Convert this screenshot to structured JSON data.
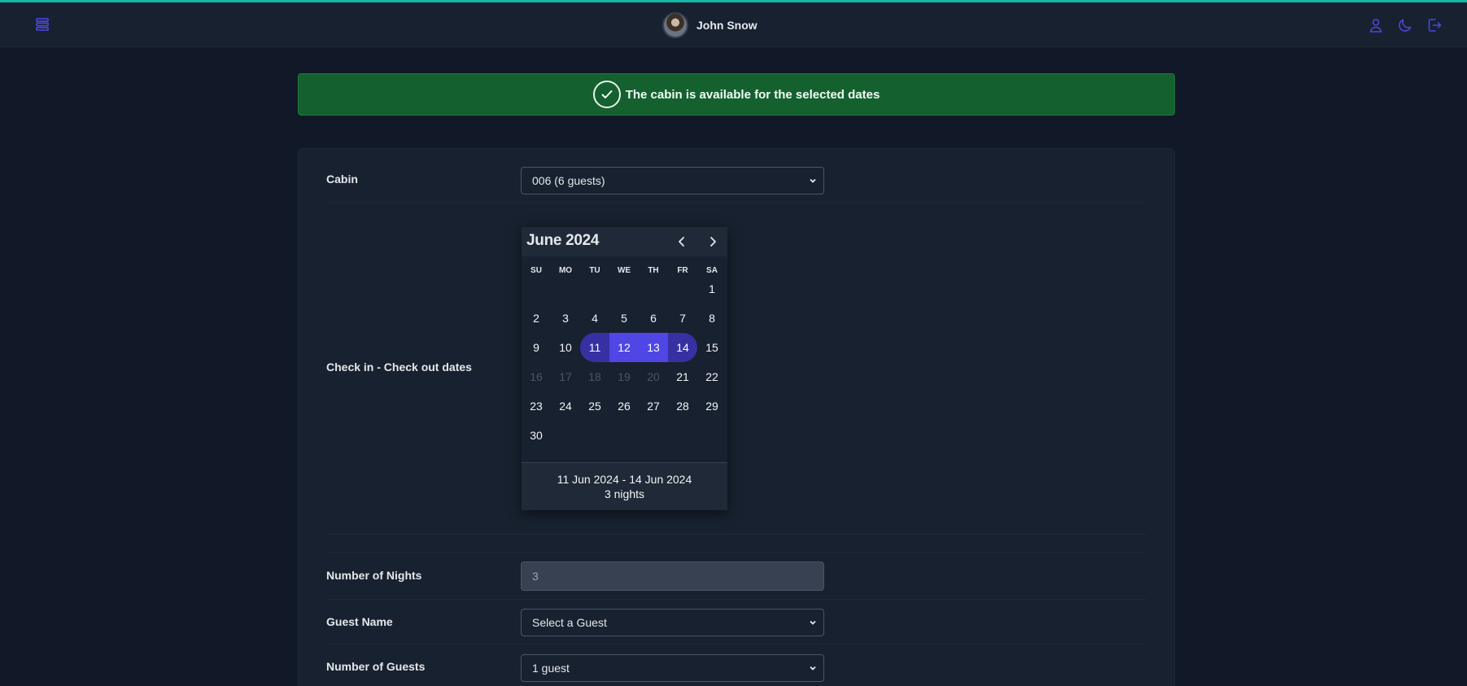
{
  "header": {
    "user_name": "John Snow",
    "accent_color": "#4f46e5",
    "icons": [
      "menu-icon",
      "user-icon",
      "moon-icon",
      "logout-icon"
    ]
  },
  "banner": {
    "message": "The cabin is available for the selected dates",
    "color": "#15602f"
  },
  "form": {
    "cabin_label": "Cabin",
    "cabin_value": "006 (6 guests)",
    "dates_label": "Check in - Check out dates",
    "nights_label": "Number of Nights",
    "nights_value": "3",
    "guest_name_label": "Guest Name",
    "guest_name_value": "Select a Guest",
    "guests_label": "Number of Guests",
    "guests_value": "1 guest"
  },
  "calendar": {
    "month_title": "June 2024",
    "weekdays": [
      "SU",
      "MO",
      "TU",
      "WE",
      "TH",
      "FR",
      "SA"
    ],
    "first_weekday_index": 6,
    "days_in_month": 30,
    "selected_start": 11,
    "selected_end": 14,
    "disabled_days": [
      16,
      17,
      18,
      19,
      20
    ],
    "range_text": "11 Jun 2024 - 14 Jun 2024",
    "nights_text": "3 nights",
    "range_color": "#4f46e5",
    "range_edge_color": "#3730a3"
  }
}
